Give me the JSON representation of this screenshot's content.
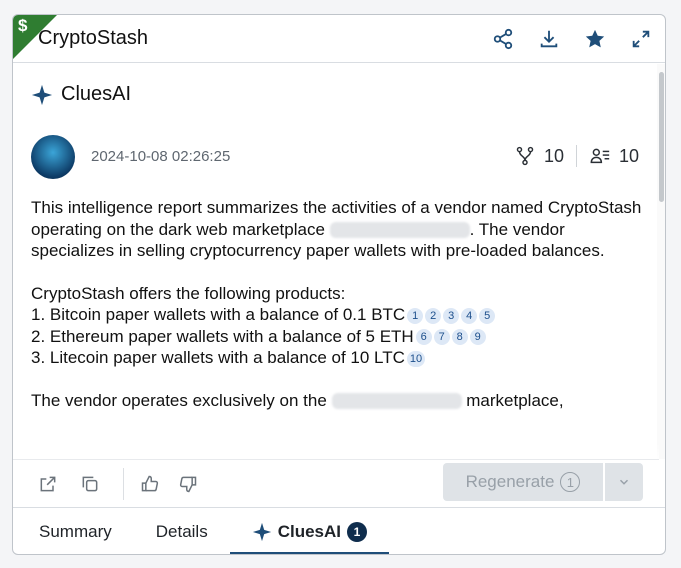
{
  "header": {
    "title": "CryptoStash",
    "corner_symbol": "$"
  },
  "clues": {
    "title": "CluesAI",
    "timestamp": "2024-10-08 02:26:25",
    "sources_count": "10",
    "entities_count": "10"
  },
  "report": {
    "p1a": "This intelligence report summarizes the activities of a vendor named CryptoStash operating on the dark web marketplace",
    "p1b": ".",
    "p1c": "The vendor specializes in selling cryptocurrency paper wallets with pre-loaded balances.",
    "p2_intro": "CryptoStash offers the following products:",
    "items": [
      {
        "text": "1. Bitcoin paper wallets with a balance of 0.1 BTC",
        "cites": [
          "1",
          "2",
          "3",
          "4",
          "5"
        ]
      },
      {
        "text": "2. Ethereum paper wallets with a balance of 5 ETH",
        "cites": [
          "6",
          "7",
          "8",
          "9"
        ]
      },
      {
        "text": "3. Litecoin paper wallets with a balance of 10 LTC",
        "cites": [
          "10"
        ]
      }
    ],
    "p3a": "The vendor operates exclusively on the",
    "p3b": "marketplace,"
  },
  "toolbar": {
    "regenerate_label": "Regenerate",
    "regenerate_count": "1"
  },
  "tabs": [
    {
      "label": "Summary"
    },
    {
      "label": "Details"
    },
    {
      "label": "CluesAI",
      "badge": "1"
    }
  ],
  "colors": {
    "corner": "#2f7d31",
    "accent": "#1f4e79",
    "citation_bg": "#dde8f6"
  }
}
